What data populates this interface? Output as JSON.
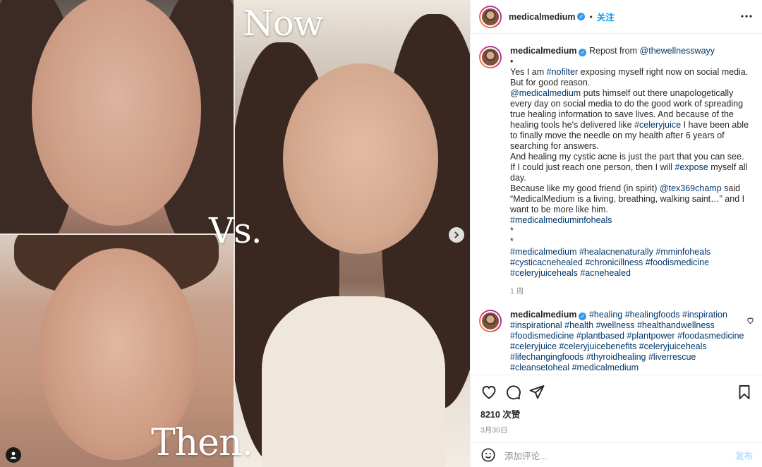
{
  "media": {
    "overlay_now": "Now",
    "overlay_vs": "Vs.",
    "overlay_then": "Then.",
    "next_icon": "chevron-right-icon",
    "tag_icon": "user-tag-icon"
  },
  "header": {
    "username": "medicalmedium",
    "verified_icon": "verified-badge-icon",
    "separator": "•",
    "follow_label": "关注",
    "more_icon": "more-horizontal-icon"
  },
  "caption": {
    "username": "medicalmedium",
    "repost_prefix": "Repost from",
    "repost_from": "@thewellnesswayy",
    "line_bullet": "•",
    "l1a": "Yes I am ",
    "l1_tag": "#nofilter",
    "l1b": " exposing myself right now on social media. But for good reason.",
    "l2_mention": "@medicalmedium",
    "l2a": " puts himself out there unapologetically every day on social media to do the good work of spreading true healing information to save lives. And because of the healing tools he's delivered like ",
    "l2_tag": "#celeryjuice",
    "l2b": " I have been able to finally move the needle on my health after 6 years of searching for answers.",
    "l3": "And healing my cystic acne is just the part that you can see.",
    "l4a": "If I could just reach one person, then I will ",
    "l4_tag": "#expose",
    "l4b": " myself all day.",
    "l5a": "Because like my good friend (in spirit) ",
    "l5_mention": "@tex369champ",
    "l5b": " said “MedicalMedium is a living, breathing, walking saint…” and I want to be more like him.",
    "l6_tag": "#medicalmediuminfoheals",
    "star1": "*",
    "star2": "*",
    "tags_a": "#medicalmedium #healacnenaturally #mminfoheals",
    "tags_b": "#cysticacnehealed #chronicillness #foodismedicine",
    "tags_c": "#celeryjuiceheals #acnehealed",
    "time": "1 周"
  },
  "comment2": {
    "username": "medicalmedium",
    "text_lines": [
      "#healing #healingfoods #inspiration",
      "#inspirational #health #wellness #healthandwellness",
      "#foodismedicine #plantbased #plantpower #foodasmedicine",
      "#celeryjuice #celeryjuicebenefits #celeryjuiceheals",
      "#lifechangingfoods #thyroidhealing #liverrescue",
      "#cleansetoheal #medicalmedium"
    ],
    "like_icon": "heart-outline-icon"
  },
  "actions": {
    "like_icon": "heart-icon",
    "comment_icon": "comment-bubble-icon",
    "share_icon": "paper-plane-icon",
    "save_icon": "bookmark-icon",
    "likes": "8210 次赞",
    "date": "3月30日"
  },
  "add_comment": {
    "emoji_icon": "smiley-icon",
    "placeholder": "添加评论...",
    "post_label": "发布"
  },
  "colors": {
    "link": "#00376b",
    "accent": "#0095f6",
    "post_disabled": "#b2dffc",
    "verified": "#3897f0"
  }
}
